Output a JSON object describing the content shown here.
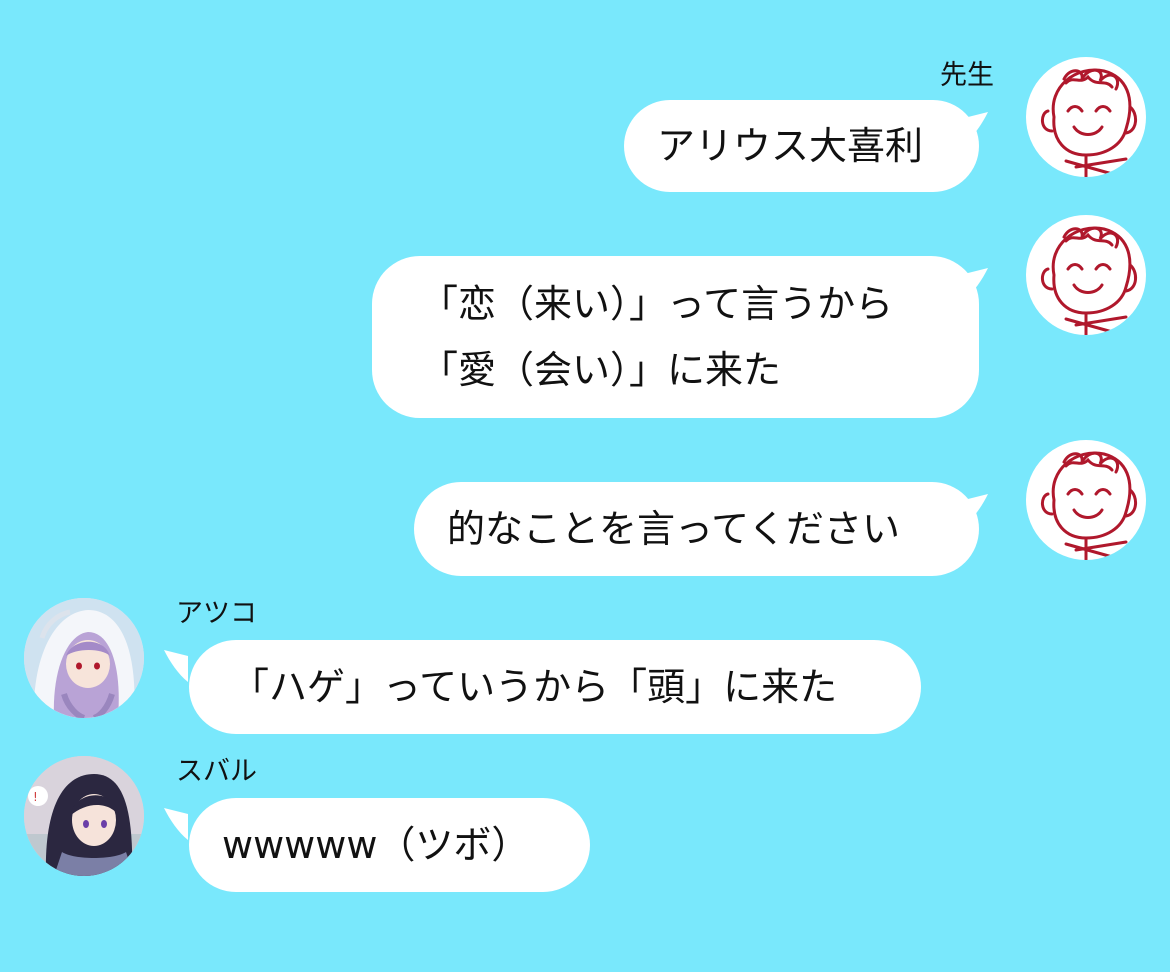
{
  "chat": {
    "background_color": "#79E8FC",
    "messages": [
      {
        "sender": "先生",
        "side": "right",
        "avatar": "teacher-doodle-avatar",
        "lines": [
          "アリウス大喜利"
        ]
      },
      {
        "sender": "",
        "side": "right",
        "avatar": "teacher-doodle-avatar",
        "lines": [
          "「恋（来い）」って言うから",
          "「愛（会い）」に来た"
        ]
      },
      {
        "sender": "",
        "side": "right",
        "avatar": "teacher-doodle-avatar",
        "lines": [
          "的なことを言ってください"
        ]
      },
      {
        "sender": "アツコ",
        "side": "left",
        "avatar": "atsuko-avatar",
        "lines": [
          "「ハゲ」っていうから「頭」に来た"
        ]
      },
      {
        "sender": "スバル",
        "side": "left",
        "avatar": "subaru-avatar",
        "lines": [
          "wwwww（ツボ）"
        ]
      }
    ]
  }
}
